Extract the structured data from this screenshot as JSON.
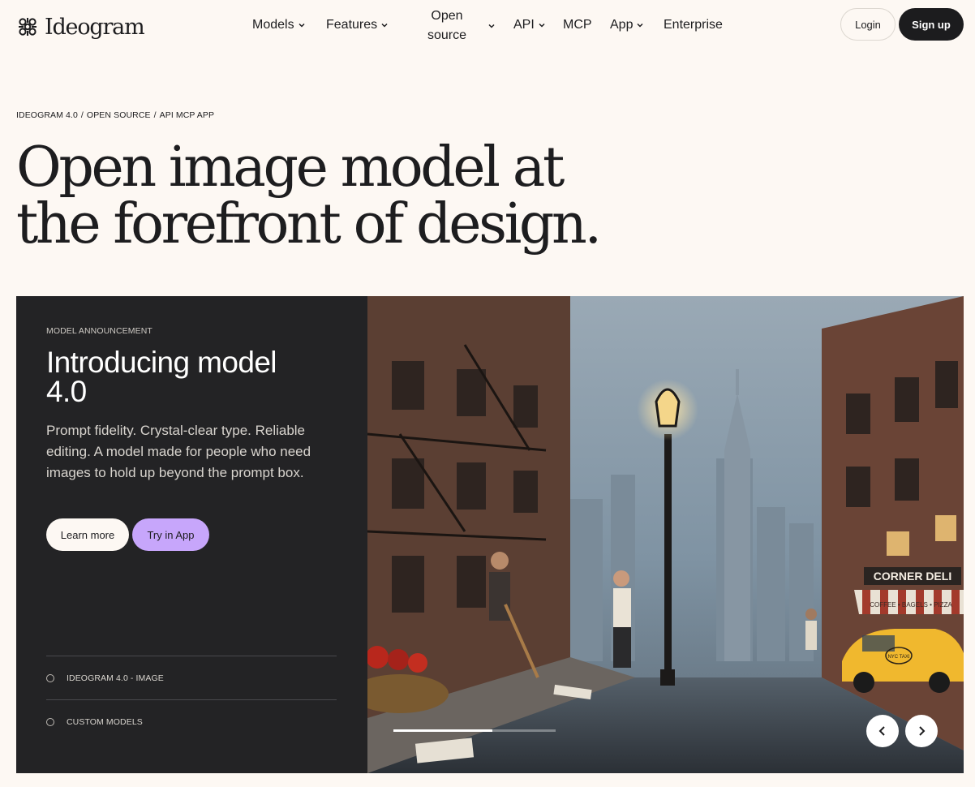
{
  "header": {
    "logo_text": "Ideogram",
    "nav": {
      "models": "Models",
      "features": "Features",
      "open_source": "Open source",
      "api": "API",
      "mcp": "MCP",
      "app": "App",
      "enterprise": "Enterprise"
    },
    "login": "Login",
    "signup": "Sign up"
  },
  "breadcrumb": {
    "part1": "IDEOGRAM 4.0",
    "sep1": "/",
    "part2": "OPEN SOURCE",
    "sep2": "/",
    "part3": "API MCP APP"
  },
  "hero": {
    "line1": "Open image model at",
    "line2": "the forefront of design."
  },
  "feature": {
    "eyebrow": "MODEL ANNOUNCEMENT",
    "title_line1": "Introducing model",
    "title_line2": "4.0",
    "description": "Prompt fidelity. Crystal-clear type. Reliable editing. A model made for people who need images to hold up beyond the prompt box.",
    "learn_more": "Learn more",
    "try_in_app": "Try in App",
    "models": [
      {
        "label": "IDEOGRAM 4.0 - IMAGE"
      },
      {
        "label": "CUSTOM MODELS"
      }
    ]
  },
  "carousel": {
    "progress": 0.61,
    "image_text": {
      "deli_sign": "CORNER DELI",
      "deli_awning": "COFFEE • BAGELS • PIZZA",
      "taxi_sign": "NYC TAXI"
    }
  },
  "colors": {
    "background": "#fdf8f3",
    "card": "#232325",
    "accent_purple": "#c7a6fb",
    "signup_dark": "#1c1c1e"
  }
}
